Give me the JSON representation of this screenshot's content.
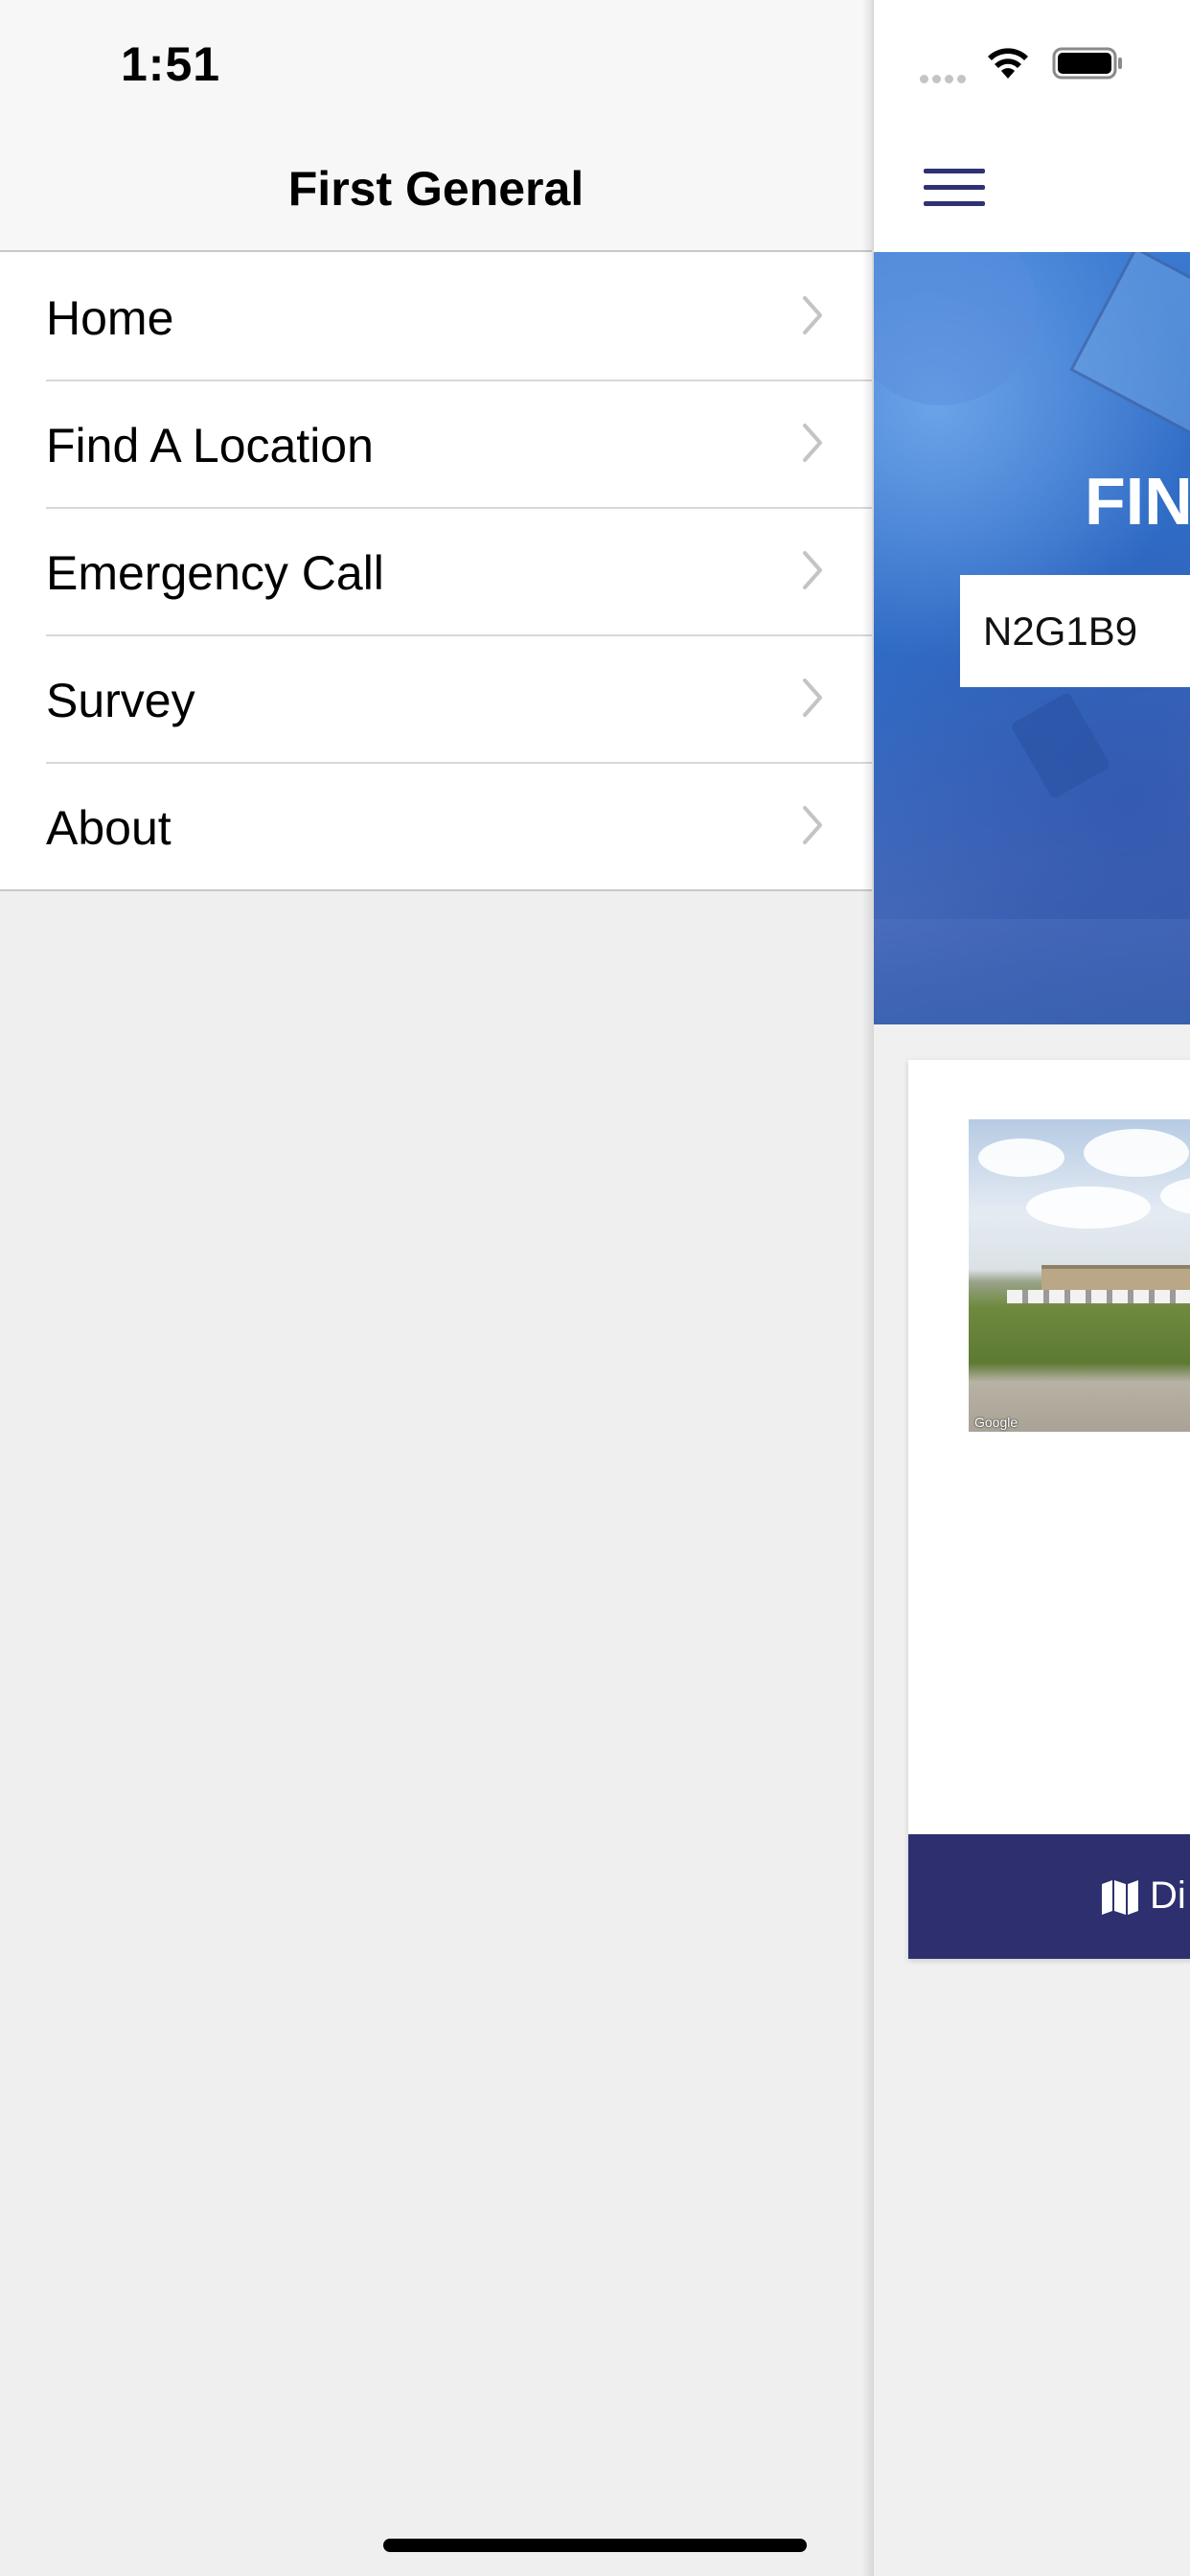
{
  "status_bar": {
    "time": "1:51"
  },
  "drawer": {
    "title": "First General",
    "items": [
      {
        "label": "Home"
      },
      {
        "label": "Find A Location"
      },
      {
        "label": "Emergency Call"
      },
      {
        "label": "Survey"
      },
      {
        "label": "About"
      }
    ]
  },
  "main": {
    "hero_title": "FIN",
    "search_value": "N2G1B9",
    "street_view_credit": "Google",
    "card_button_label": "Di"
  },
  "colors": {
    "accent": "#303173",
    "hero_blue": "#3f7fd4",
    "footer_navy": "#2e2f6e"
  },
  "icons": [
    "chevron-right-icon",
    "wifi-icon",
    "battery-icon",
    "cellular-signal-icon",
    "hamburger-menu-icon",
    "map-icon"
  ]
}
